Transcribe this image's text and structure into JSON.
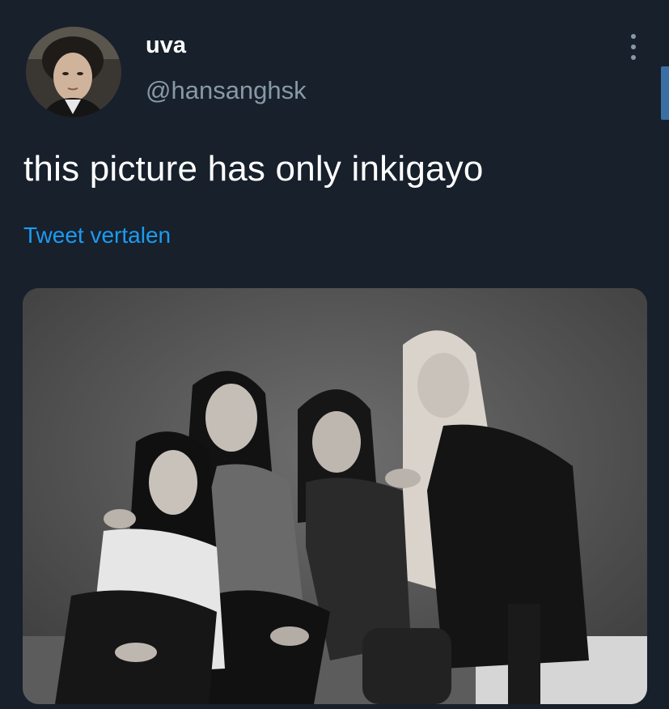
{
  "tweet": {
    "author": {
      "display_name": "uva",
      "handle": "@hansanghsk",
      "avatar_icon": "profile-photo"
    },
    "text": "this picture has only inkigayo",
    "translate_label": "Tweet vertalen",
    "more_icon": "vertical-ellipsis-icon",
    "media": {
      "type": "photo",
      "style": "black-and-white group photo"
    }
  },
  "colors": {
    "background": "#17202b",
    "primary_text": "#ffffff",
    "secondary_text": "#8899a6",
    "link": "#1d9bf0"
  }
}
